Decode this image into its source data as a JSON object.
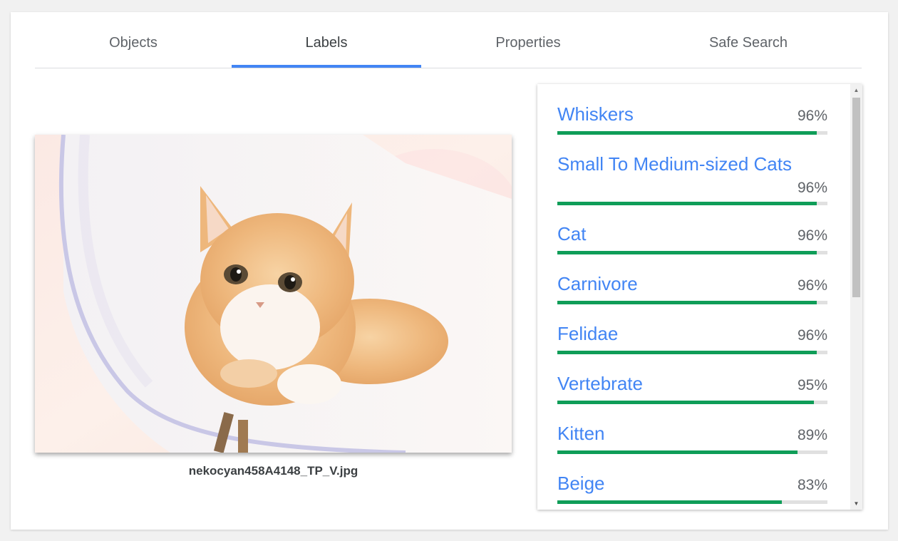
{
  "tabs": [
    {
      "label": "Objects"
    },
    {
      "label": "Labels"
    },
    {
      "label": "Properties"
    },
    {
      "label": "Safe Search"
    }
  ],
  "active_tab": "Labels",
  "image": {
    "filename": "nekocyan458A4148_TP_V.jpg"
  },
  "labels": [
    {
      "name": "Whiskers",
      "score": "96%",
      "value": 0.96
    },
    {
      "name": "Small To Medium-sized Cats",
      "score": "96%",
      "value": 0.96
    },
    {
      "name": "Cat",
      "score": "96%",
      "value": 0.96
    },
    {
      "name": "Carnivore",
      "score": "96%",
      "value": 0.96
    },
    {
      "name": "Felidae",
      "score": "96%",
      "value": 0.96
    },
    {
      "name": "Vertebrate",
      "score": "95%",
      "value": 0.95
    },
    {
      "name": "Kitten",
      "score": "89%",
      "value": 0.89
    },
    {
      "name": "Beige",
      "score": "83%",
      "value": 0.83
    }
  ],
  "colors": {
    "accent": "#4285f4",
    "bar": "#0f9d58",
    "bar_track": "#e0e0e0"
  }
}
